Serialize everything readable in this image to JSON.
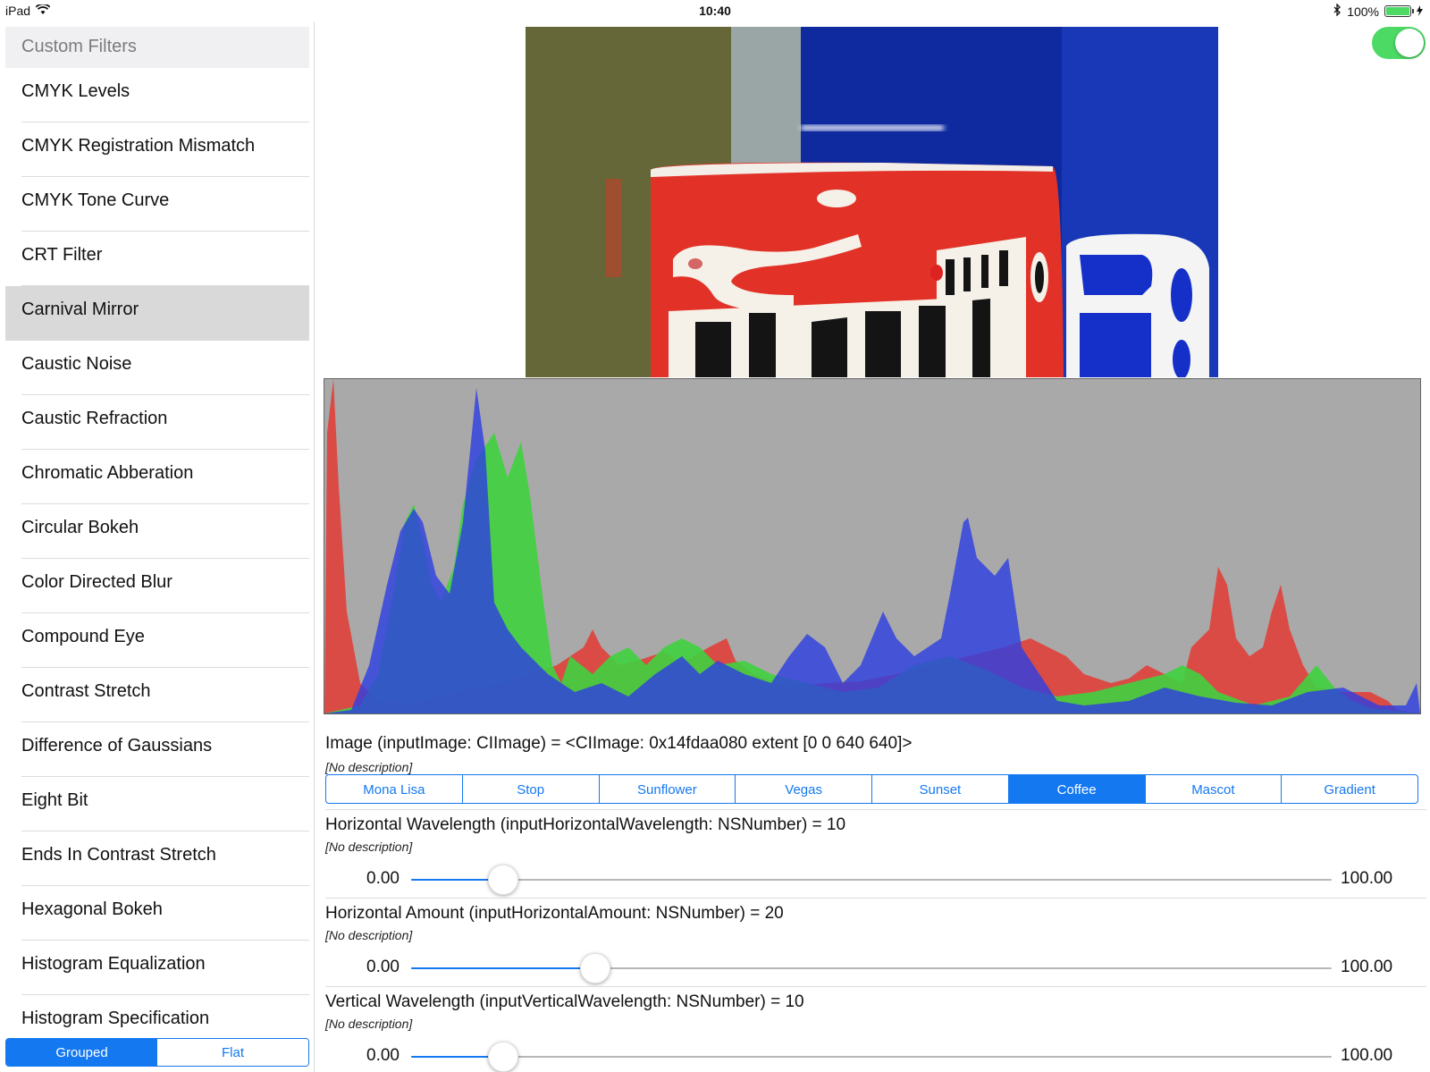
{
  "status_bar": {
    "device": "iPad",
    "time": "10:40",
    "battery": "100%"
  },
  "sidebar": {
    "section_header": "Custom Filters",
    "selected_index": 4,
    "items": [
      {
        "label": "CMYK Levels"
      },
      {
        "label": "CMYK Registration Mismatch"
      },
      {
        "label": "CMYK Tone Curve"
      },
      {
        "label": "CRT Filter"
      },
      {
        "label": "Carnival Mirror"
      },
      {
        "label": "Caustic Noise"
      },
      {
        "label": "Caustic Refraction"
      },
      {
        "label": "Chromatic Abberation"
      },
      {
        "label": "Circular Bokeh"
      },
      {
        "label": "Color Directed Blur"
      },
      {
        "label": "Compound Eye"
      },
      {
        "label": "Contrast Stretch"
      },
      {
        "label": "Difference of Gaussians"
      },
      {
        "label": "Eight Bit"
      },
      {
        "label": "Ends In Contrast Stretch"
      },
      {
        "label": "Hexagonal Bokeh"
      },
      {
        "label": "Histogram Equalization"
      },
      {
        "label": "Histogram Specification"
      }
    ],
    "mode_segments": [
      {
        "label": "Grouped",
        "active": true
      },
      {
        "label": "Flat",
        "active": false
      }
    ]
  },
  "toggle": {
    "on": true
  },
  "image_param": {
    "title": "Image (inputImage: CIImage) = <CIImage: 0x14fdaa080 extent [0 0 640 640]>",
    "description": "[No description]",
    "options": [
      "Mona Lisa",
      "Stop",
      "Sunflower",
      "Vegas",
      "Sunset",
      "Coffee",
      "Mascot",
      "Gradient"
    ],
    "selected": "Coffee"
  },
  "params": [
    {
      "title": "Horizontal Wavelength (inputHorizontalWavelength: NSNumber) = 10",
      "description": "[No description]",
      "min_label": "0.00",
      "max_label": "100.00",
      "value": 10
    },
    {
      "title": "Horizontal Amount (inputHorizontalAmount: NSNumber) = 20",
      "description": "[No description]",
      "min_label": "0.00",
      "max_label": "100.00",
      "value": 20
    },
    {
      "title": "Vertical Wavelength (inputVerticalWavelength: NSNumber) = 10",
      "description": "[No description]",
      "min_label": "0.00",
      "max_label": "100.00",
      "value": 10
    }
  ],
  "colors": {
    "accent": "#1478f0",
    "toggle_on": "#4cd964",
    "histogram_red": "#e0403a",
    "histogram_green": "#3fd23f",
    "histogram_blue": "#2e3fe0",
    "histogram_background": "#a9a9a9"
  }
}
